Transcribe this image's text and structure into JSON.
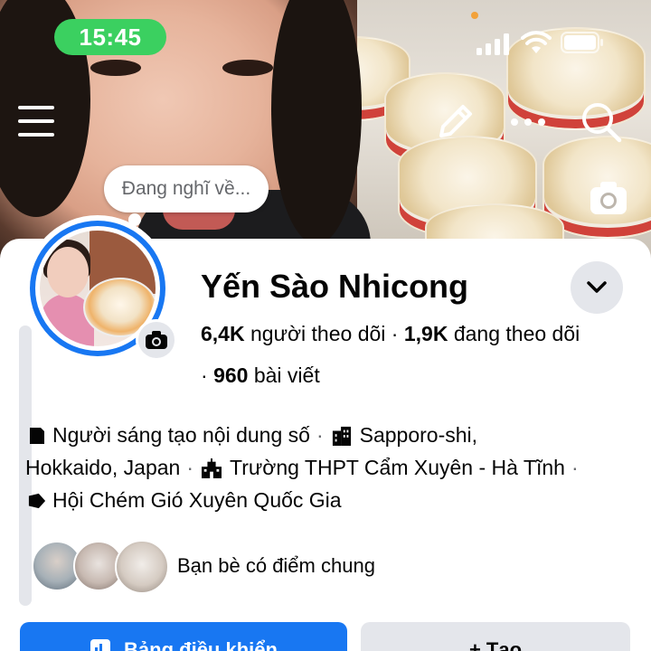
{
  "status_bar": {
    "time": "15:45"
  },
  "cover": {
    "thought_bubble": "Đang nghĩ về..."
  },
  "profile": {
    "name": "Yến Sào Nhicong",
    "followers_count": "6,4K",
    "followers_label": "người theo dõi",
    "following_count": "1,9K",
    "following_label": "đang theo dõi",
    "posts_count": "960",
    "posts_label": "bài viết",
    "separator": "·"
  },
  "intro": {
    "row1_a": "Người sáng tạo nội dung số",
    "row1_b": "Sapporo-shi,",
    "row2_a": "Hokkaido, Japan",
    "row2_b": "Trường THPT Cẩm Xuyên - Hà Tĩnh",
    "row3_a": "Hội Chém Gió Xuyên Quốc Gia"
  },
  "friends": {
    "label": "Bạn bè có điểm chung"
  },
  "actions": {
    "primary": "Bảng điều khiển",
    "secondary": "+ Tạo"
  },
  "colors": {
    "accent": "#1877f2",
    "status_green": "#3bd060",
    "button_gray": "#e4e6eb"
  }
}
